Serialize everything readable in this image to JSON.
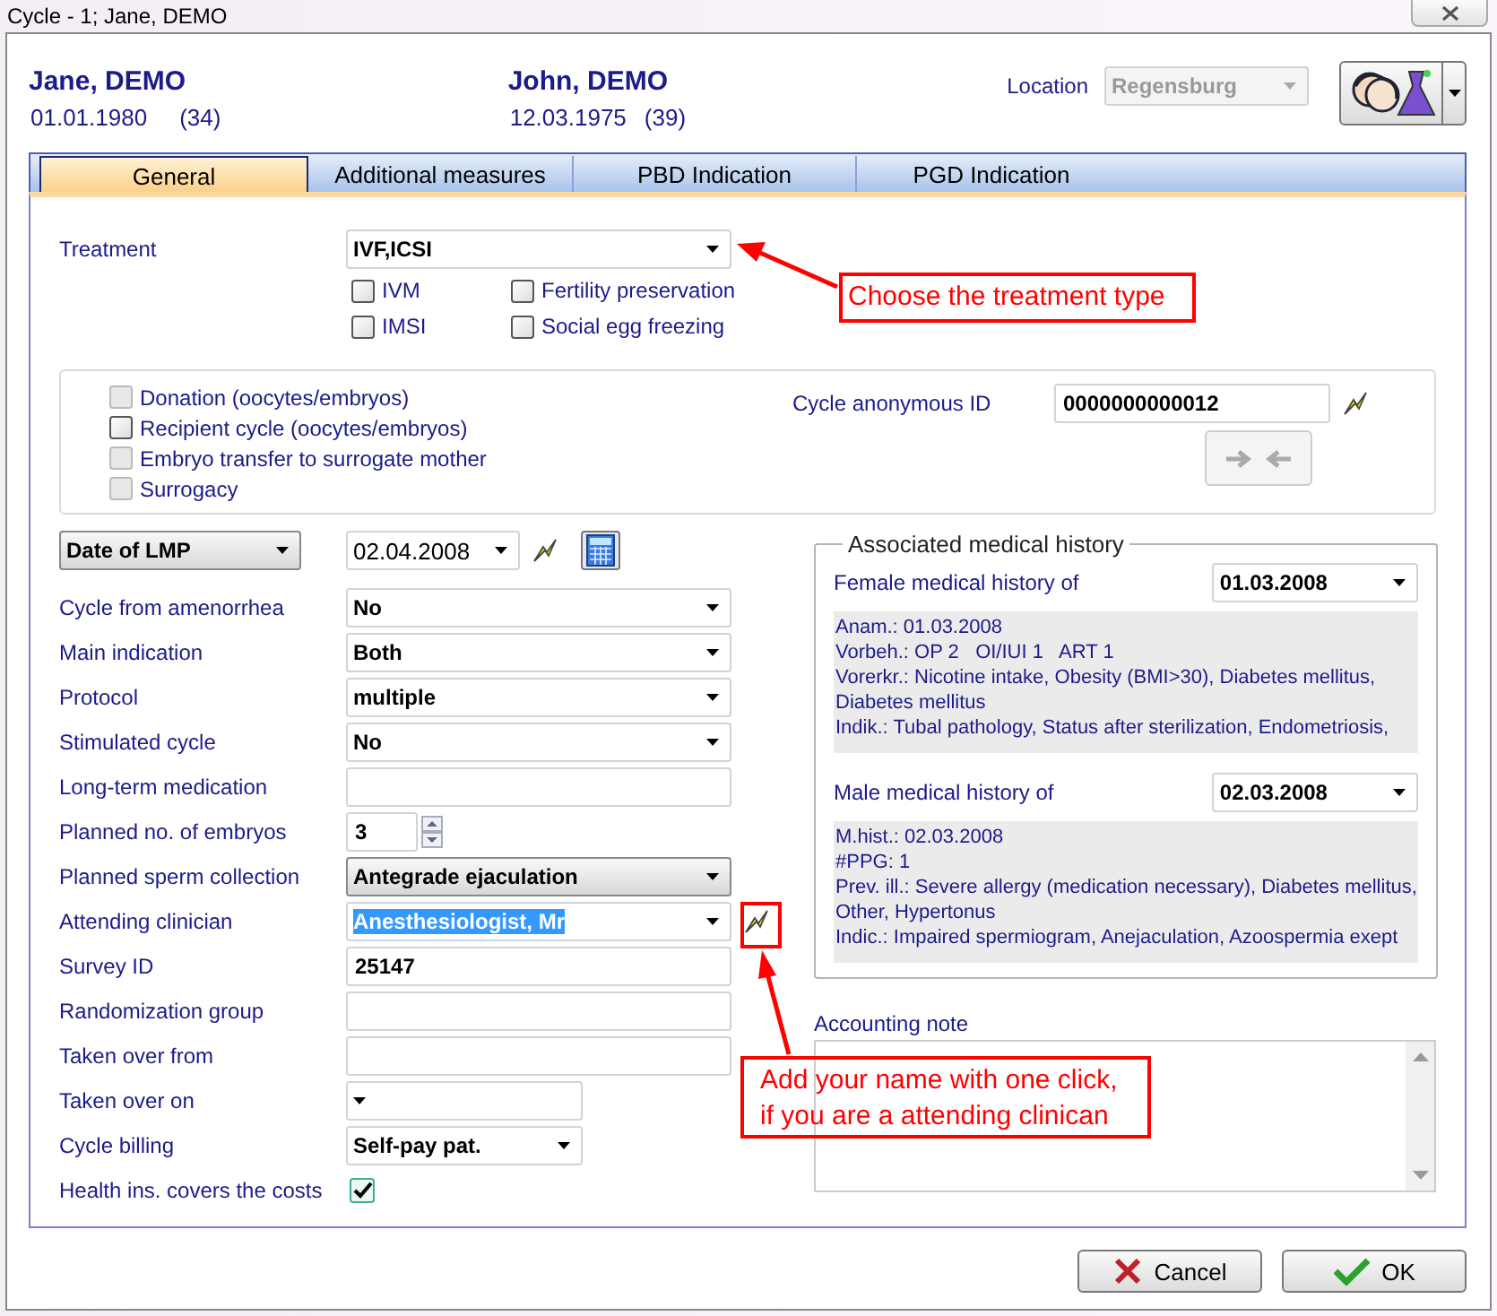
{
  "window": {
    "title": "Cycle - 1; Jane, DEMO"
  },
  "patients": [
    {
      "name": "Jane, DEMO",
      "birth_date": "01.01.1980",
      "age": "(34)"
    },
    {
      "name": "John, DEMO",
      "birth_date": "12.03.1975",
      "age": "(39)"
    }
  ],
  "location": {
    "label": "Location",
    "value": "Regensburg",
    "disabled": true
  },
  "tabs": [
    {
      "label": "General",
      "selected": true
    },
    {
      "label": "Additional measures",
      "selected": false
    },
    {
      "label": "PBD Indication",
      "selected": false
    },
    {
      "label": "PGD Indication",
      "selected": false
    }
  ],
  "treatment": {
    "label": "Treatment",
    "value": "IVF,ICSI",
    "options": [
      {
        "label": "IVM",
        "checked": false
      },
      {
        "label": "Fertility preservation",
        "checked": false
      },
      {
        "label": "IMSI",
        "checked": false
      },
      {
        "label": "Social egg freezing",
        "checked": false
      }
    ]
  },
  "cycle_types": [
    {
      "label": "Donation (oocytes/embryos)",
      "checked": false,
      "disabled": true
    },
    {
      "label": "Recipient cycle (oocytes/embryos)",
      "checked": false,
      "disabled": false
    },
    {
      "label": "Embryo transfer to surrogate mother",
      "checked": false,
      "disabled": true
    },
    {
      "label": "Surrogacy",
      "checked": false,
      "disabled": true
    }
  ],
  "anonymous_id": {
    "label": "Cycle anonymous ID",
    "value": "0000000000012"
  },
  "date_selector": {
    "value": "Date of LMP",
    "date": "02.04.2008"
  },
  "fields": [
    {
      "kind": "select",
      "label": "Cycle from amenorrhea",
      "value": "No"
    },
    {
      "kind": "select",
      "label": "Main indication",
      "value": "Both"
    },
    {
      "kind": "select",
      "label": "Protocol",
      "value": "multiple"
    },
    {
      "kind": "select",
      "label": "Stimulated cycle",
      "value": "No"
    },
    {
      "kind": "text",
      "label": "Long-term medication"
    },
    {
      "kind": "spin",
      "label": "Planned no. of embryos",
      "value": "3"
    },
    {
      "kind": "button-select",
      "label": "Planned sperm collection",
      "value": "Antegrade ejaculation"
    },
    {
      "kind": "quick-select",
      "label": "Attending clinician",
      "value": "Anesthesiologist, Mr",
      "highlighted": true
    },
    {
      "kind": "text",
      "label": "Survey ID",
      "value": "25147"
    },
    {
      "kind": "text",
      "label": "Randomization group"
    },
    {
      "kind": "text",
      "label": "Taken over from"
    },
    {
      "kind": "short-select",
      "label": "Taken over on"
    },
    {
      "kind": "short-select",
      "label": "Cycle billing",
      "value": "Self-pay pat."
    },
    {
      "kind": "checkbox",
      "label": "Health ins. covers the costs",
      "checked": true
    }
  ],
  "medical_history": {
    "title": "Associated medical history",
    "sections": [
      {
        "label": "Female medical history of",
        "date": "01.03.2008",
        "lines": [
          "Anam.: 01.03.2008",
          "Vorbeh.: OP 2   OI/IUI 1   ART 1",
          "Vorerkr.: Nicotine intake, Obesity (BMI>30), Diabetes mellitus,",
          "Diabetes mellitus",
          "Indik.: Tubal pathology, Status after sterilization, Endometriosis,"
        ]
      },
      {
        "label": "Male medical history of",
        "date": "02.03.2008",
        "lines": [
          "M.hist.: 02.03.2008",
          "#PPG: 1",
          "Prev. ill.: Severe allergy (medication necessary), Diabetes mellitus,",
          "Other, Hypertonus",
          "Indic.: Impaired spermiogram, Anejaculation, Azoospermia exept"
        ]
      }
    ]
  },
  "accounting_note": {
    "label": "Accounting note"
  },
  "buttons": [
    {
      "kind": "cancel",
      "label": "Cancel"
    },
    {
      "kind": "ok",
      "label": "OK"
    }
  ],
  "annotations": [
    {
      "text": "Choose the treatment type"
    },
    {
      "text": "Add your name with one click,\nif you are a attending clinican"
    }
  ]
}
